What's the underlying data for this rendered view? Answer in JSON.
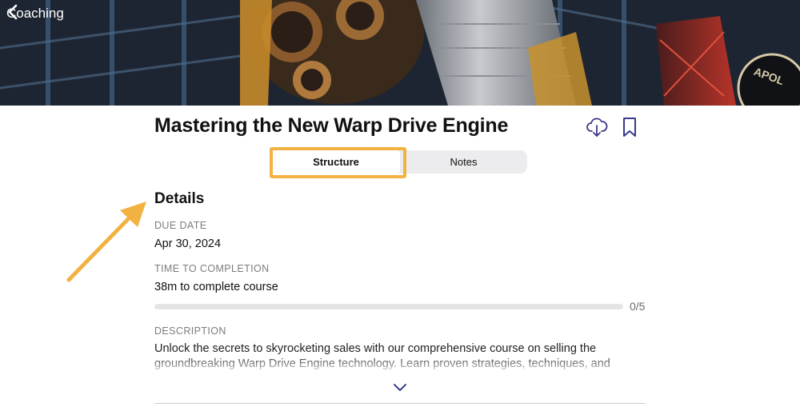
{
  "nav": {
    "back_label": "Coaching"
  },
  "course": {
    "title": "Mastering the New Warp Drive Engine"
  },
  "tabs": [
    {
      "label": "Structure",
      "active": true
    },
    {
      "label": "Notes",
      "active": false
    }
  ],
  "details": {
    "heading": "Details",
    "due_date_label": "DUE DATE",
    "due_date": "Apr 30, 2024",
    "time_label": "TIME TO COMPLETION",
    "time_value": "38m",
    "time_suffix": " to complete course",
    "progress_text": "0/5",
    "progress_fraction": 0,
    "description_label": "DESCRIPTION",
    "description": "Unlock the secrets to skyrocketing sales with our comprehensive course on selling the groundbreaking Warp Drive Engine technology. Learn proven strategies, techniques, and insights"
  },
  "icons": {
    "back": "chevron-left-icon",
    "download": "cloud-download-icon",
    "bookmark": "bookmark-icon",
    "expand": "chevron-down-icon"
  },
  "colors": {
    "accent": "#3a3a8c",
    "highlight": "#f2b242",
    "progress_track": "#e5e5e8"
  }
}
